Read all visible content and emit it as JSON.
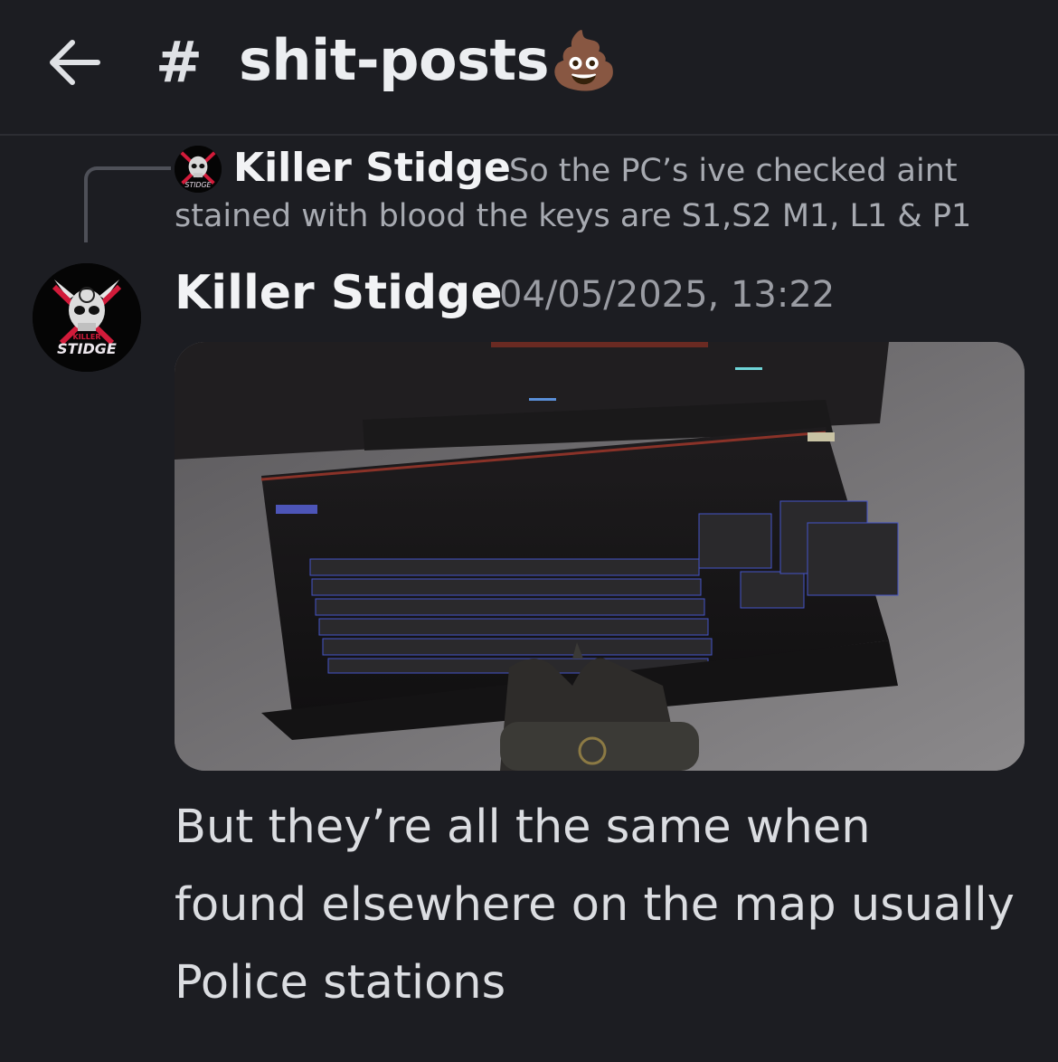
{
  "header": {
    "back_icon": "arrow-left-icon",
    "hash_symbol": "#",
    "channel_name": "shit-posts💩"
  },
  "reply": {
    "avatar_icon": "killer-stidge-avatar",
    "author": "Killer Stidge",
    "text": "So the PC’s ive checked aint stained with blood the keys are S1,S2 M1, L1 & P1"
  },
  "message": {
    "avatar_icon": "killer-stidge-avatar",
    "author": "Killer Stidge",
    "timestamp": "04/05/2025, 13:22",
    "attachment": "keyboard-screenshot",
    "text": "But they’re all the same when found elsewhere on the map usually Police stations"
  },
  "logo_text": {
    "line1": "KILLER",
    "line2": "STIDGE"
  },
  "colors": {
    "background": "#1c1d22",
    "muted_text": "#a7aab1",
    "timestamp": "#9a9ca3"
  }
}
